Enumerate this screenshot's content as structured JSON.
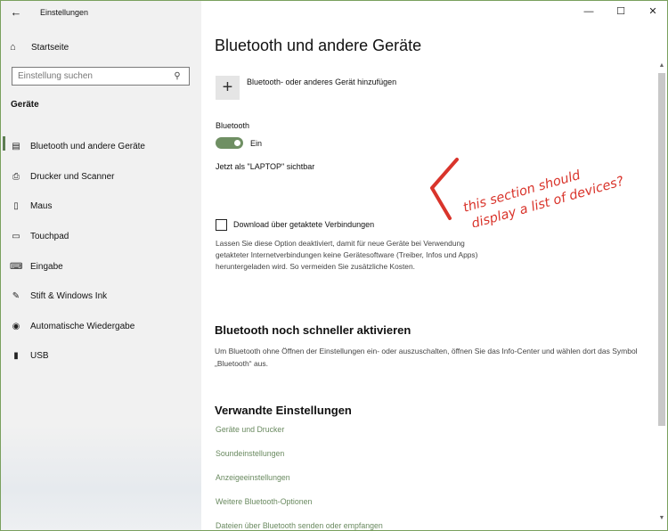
{
  "window": {
    "title": "Einstellungen",
    "controls": {
      "minimize": "—",
      "maximize": "☐",
      "close": "✕"
    }
  },
  "sidebar": {
    "back_icon": "←",
    "home": {
      "icon": "home-icon",
      "glyph": "⌂",
      "label": "Startseite"
    },
    "search": {
      "placeholder": "Einstellung suchen",
      "value": "",
      "icon_glyph": "⚲"
    },
    "section": "Geräte",
    "items": [
      {
        "icon": "bluetooth-devices-icon",
        "glyph": "▤",
        "label": "Bluetooth und andere Geräte",
        "active": true
      },
      {
        "icon": "printer-icon",
        "glyph": "⎙",
        "label": "Drucker und Scanner"
      },
      {
        "icon": "mouse-icon",
        "glyph": "▯",
        "label": "Maus"
      },
      {
        "icon": "touchpad-icon",
        "glyph": "▭",
        "label": "Touchpad"
      },
      {
        "icon": "keyboard-icon",
        "glyph": "⌨",
        "label": "Eingabe"
      },
      {
        "icon": "pen-icon",
        "glyph": "✎",
        "label": "Stift & Windows Ink"
      },
      {
        "icon": "autoplay-icon",
        "glyph": "◉",
        "label": "Automatische Wiedergabe"
      },
      {
        "icon": "usb-icon",
        "glyph": "▮",
        "label": "USB"
      }
    ]
  },
  "main": {
    "title": "Bluetooth und andere Geräte",
    "add_device": {
      "glyph": "+",
      "label": "Bluetooth- oder anderes Gerät hinzufügen"
    },
    "bluetooth": {
      "label": "Bluetooth",
      "state": "Ein",
      "on": true,
      "visible_as": "Jetzt als \"LAPTOP\" sichtbar"
    },
    "metered": {
      "label": "Download über getaktete Verbindungen",
      "checked": false,
      "description": "Lassen Sie diese Option deaktiviert, damit für neue Geräte bei Verwendung getakteter Internetverbindungen keine Gerätesoftware (Treiber, Infos und Apps) heruntergeladen wird. So vermeiden Sie zusätzliche Kosten."
    },
    "faster": {
      "title": "Bluetooth noch schneller aktivieren",
      "text": "Um Bluetooth ohne Öffnen der Einstellungen ein- oder auszuschalten, öffnen Sie das Info-Center und wählen dort das Symbol „Bluetooth“ aus."
    },
    "related": {
      "title": "Verwandte Einstellungen",
      "links": [
        "Geräte und Drucker",
        "Soundeinstellungen",
        "Anzeigeeinstellungen",
        "Weitere Bluetooth-Optionen",
        "Dateien über Bluetooth senden oder empfangen"
      ]
    },
    "annotation": {
      "line1": "this section should",
      "line2": "display a list of devices?",
      "color": "#d9342b"
    }
  },
  "colors": {
    "accent": "#6f8f63",
    "link": "#6a8a60",
    "annotation": "#d9342b"
  }
}
